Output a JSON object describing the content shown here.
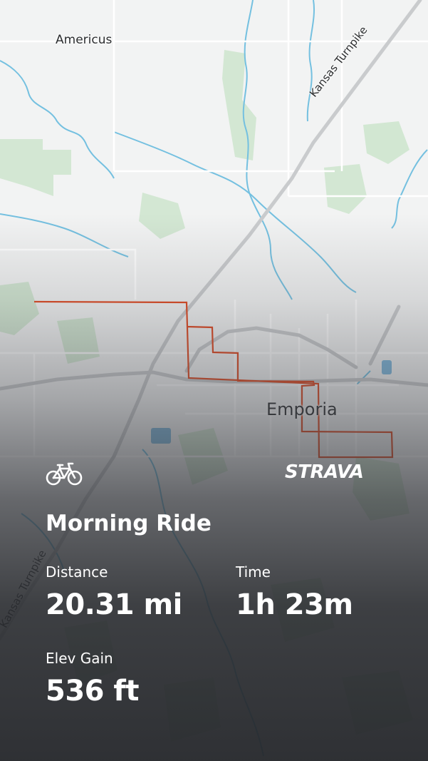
{
  "map": {
    "labels": {
      "americus": "Americus",
      "kansas_turnpike_ne": "Kansas Turnpike",
      "emporia": "Emporia",
      "kansas_turnpike_sw": "Kansas Turnpike"
    },
    "colors": {
      "background": "#f2f3f3",
      "water": "#74c0e0",
      "vegetation": "#cfe6cf",
      "road": "#ffffff",
      "highway": "#c9cbcd",
      "route": "#e0461e"
    }
  },
  "activity": {
    "icon": "bicycle-icon",
    "brand": "STRAVA",
    "title": "Morning Ride",
    "stats": {
      "distance_label": "Distance",
      "distance_value": "20.31 mi",
      "time_label": "Time",
      "time_value": "1h 23m",
      "elev_label": "Elev Gain",
      "elev_value": "536 ft"
    }
  }
}
